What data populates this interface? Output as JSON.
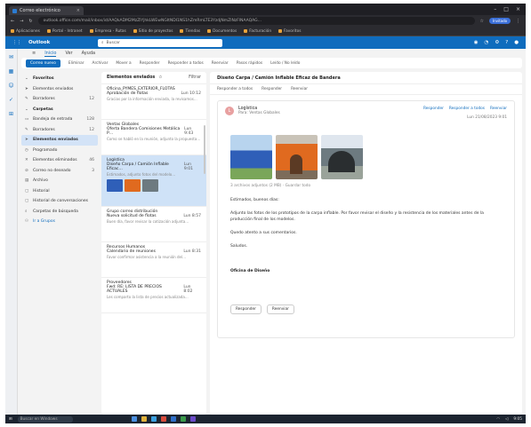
{
  "browser": {
    "tab_title": "Correo electrónico",
    "url": "outlook.office.com/mail/inbox/id/AAQkADM2MzZlYjhkLWEwNGItNDI1NS1hZmRmLTE3YzdjNmZlNzFlNAAQAG…",
    "profile": "Invitado",
    "bookmarks": [
      "Aplicaciones",
      "Portal - Intranet",
      "Empresa - Rutas",
      "Sitio de proyectos",
      "Tiendas",
      "Documentos",
      "Facturación",
      "Favoritos"
    ]
  },
  "outlook": {
    "app_title": "Outlook",
    "search_placeholder": "Buscar",
    "ribbon_tabs": [
      "Inicio",
      "Ver",
      "Ayuda"
    ],
    "ribbon_actions": {
      "new_mail": "Correo nuevo",
      "delete": "Eliminar",
      "archive": "Archivar",
      "move": "Mover a",
      "reply": "Responder",
      "reply_all": "Responder a todos",
      "forward": "Reenviar",
      "quick_steps": "Pasos rápidos",
      "read_unread": "Leído / No leído"
    }
  },
  "folders": [
    {
      "label": "Favoritos",
      "type": "group",
      "icon": "chevron-down-icon"
    },
    {
      "label": "Elementos enviados",
      "type": "item",
      "icon": "send-icon",
      "count": ""
    },
    {
      "label": "Borradores",
      "type": "item",
      "icon": "pencil-icon",
      "count": "12"
    },
    {
      "label": "Carpetas",
      "type": "group",
      "icon": "chevron-down-icon"
    },
    {
      "label": "Bandeja de entrada",
      "type": "item",
      "icon": "inbox-icon",
      "count": "128"
    },
    {
      "label": "Borradores",
      "type": "item",
      "icon": "pencil-icon",
      "count": "12"
    },
    {
      "label": "Elementos enviados",
      "type": "selected",
      "icon": "send-icon",
      "count": ""
    },
    {
      "label": "Programado",
      "type": "item",
      "icon": "clock-icon",
      "count": ""
    },
    {
      "label": "Elementos eliminados",
      "type": "item",
      "icon": "trash-icon",
      "count": "46"
    },
    {
      "label": "Correo no deseado",
      "type": "item",
      "icon": "junk-icon",
      "count": "3"
    },
    {
      "label": "Archivo",
      "type": "item",
      "icon": "archive-icon",
      "count": ""
    },
    {
      "label": "Historial",
      "type": "item",
      "icon": "folder-icon",
      "count": ""
    },
    {
      "label": "Historial de conversaciones",
      "type": "item",
      "icon": "folder-icon",
      "count": ""
    },
    {
      "label": "Carpetas de búsqueda",
      "type": "item",
      "icon": "search-folder-icon",
      "count": ""
    },
    {
      "label": "Ir a Grupos",
      "type": "link",
      "icon": "groups-icon",
      "count": ""
    }
  ],
  "maillist": {
    "header": "Elementos enviados",
    "filter": "Filtrar",
    "mails": [
      {
        "from": "Oficina_PYMES_EXTERIOR_FLOTAS",
        "subject": "Aprobación de flotas",
        "date": "Lun 10:12",
        "preview": "Gracias por la información enviada, la revisamos…",
        "selected": false,
        "thumbs": false
      },
      {
        "from": "Ventas Globales",
        "subject": "Oferta Bandera Comisiones Metálica P…",
        "date": "Lun 9:43",
        "preview": "Como se habló en la reunión, adjunto la propuesta…",
        "selected": false,
        "thumbs": false
      },
      {
        "from": "Logística",
        "subject": "Diseño Carpa / Camión Inflable Eficac…",
        "date": "Lun 9:01",
        "preview": "Estimados, adjunto fotos del modelo…",
        "selected": true,
        "thumbs": true
      },
      {
        "from": "Grupo correo distribución",
        "subject": "Nueva solicitud de flotas",
        "date": "Lun 8:57",
        "preview": "Buen día, favor revisar la cotización adjunta…",
        "selected": false,
        "thumbs": false
      },
      {
        "from": "Recursos Humanos",
        "subject": "Calendario de reuniones",
        "date": "Lun 8:31",
        "preview": "Favor confirmar asistencia a la reunión del…",
        "selected": false,
        "thumbs": false
      },
      {
        "from": "Proveedores",
        "subject": "Fwd: RE: LISTA DE PRECIOS ACTUALES",
        "date": "Lun 8:02",
        "preview": "Les comparto la lista de precios actualizada…",
        "selected": false,
        "thumbs": false
      }
    ]
  },
  "reading": {
    "subject": "Diseño Carpa / Camión Inflable Eficaz de Bandera",
    "actions": [
      "Responder a todos",
      "Responder",
      "Reenviar"
    ],
    "sender_name": "Logística",
    "sender_initial": "L",
    "sender_to": "Para: Ventas Globales",
    "msg_actions": [
      "Responder",
      "Responder a todos",
      "Reenviar"
    ],
    "date": "Lun 21/08/2023 9:01",
    "attachments_line": "3 archivos adjuntos (2 MB) · Guardar todo",
    "body": [
      "Estimados, buenos días:",
      "Adjunto las fotos de los prototipos de la carpa inflable. Por favor revisar el diseño y la resistencia de los materiales antes de la producción final de los modelos.",
      "Quedo atento a sus comentarios.",
      "Saludos."
    ],
    "signature": "Oficina de Diseño",
    "reply_buttons": [
      "Responder",
      "Reenviar"
    ]
  },
  "taskbar": {
    "search": "Buscar en Windows",
    "time": "9:05"
  }
}
